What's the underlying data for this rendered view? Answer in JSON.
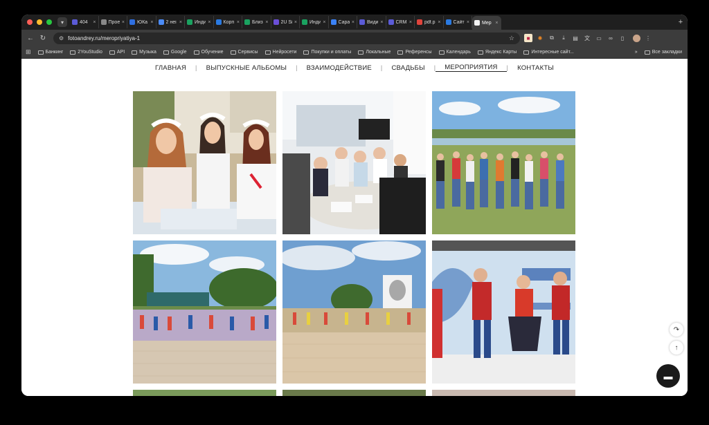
{
  "browser": {
    "tabs": [
      {
        "title": "404",
        "fav": "#5b5bd6"
      },
      {
        "title": "Прое",
        "fav": "#888888"
      },
      {
        "title": "ЮКа",
        "fav": "#2f6fe0"
      },
      {
        "title": "2 неі",
        "fav": "#4b8bf5"
      },
      {
        "title": "Инди",
        "fav": "#1aa260"
      },
      {
        "title": "Корп",
        "fav": "#2a7ae2"
      },
      {
        "title": "Близ",
        "fav": "#1aa260"
      },
      {
        "title": "2U Si",
        "fav": "#6b4fd8"
      },
      {
        "title": "Инди",
        "fav": "#1aa260"
      },
      {
        "title": "Сара",
        "fav": "#3b82f6"
      },
      {
        "title": "Види",
        "fav": "#5b5bd6"
      },
      {
        "title": "CRM",
        "fav": "#5b5bd6"
      },
      {
        "title": "pdf.p",
        "fav": "#e0443c"
      },
      {
        "title": "Сайт",
        "fav": "#2a7ae2"
      },
      {
        "title": "Мер",
        "fav": "#f2f2f2"
      }
    ],
    "active_tab_index": 14,
    "url": "fotoandrey.ru/meropriyatiya-1",
    "bookmarks": [
      "Банкинг",
      "2YouStudio",
      "API",
      "Музыка",
      "Google",
      "Обучение",
      "Сервисы",
      "Нейросети",
      "Покупки и оплаты",
      "Локальные",
      "Референсы",
      "Календарь",
      "Яндекс Карты",
      "Интересные сайт..."
    ],
    "bookmarks_more": "»",
    "all_bookmarks": "Все закладки"
  },
  "site": {
    "nav": [
      "ГЛАВНАЯ",
      "ВЫПУСКНЫЕ АЛЬБОМЫ",
      "ВЗАИМОДЕЙСТВИЕ",
      "СВАДЬБЫ",
      "МЕРОПРИЯТИЯ",
      "КОНТАКТЫ"
    ],
    "nav_current": "МЕРОПРИЯТИЯ",
    "photos": [
      {
        "name": "photo-girls-flower-wreaths"
      },
      {
        "name": "photo-meeting-table"
      },
      {
        "name": "photo-group-riverbank"
      },
      {
        "name": "photo-large-crowd-lawn"
      },
      {
        "name": "photo-crowd-portrait-monument"
      },
      {
        "name": "photo-singers-stage"
      }
    ]
  },
  "colors": {
    "chat": "#1a1a1a",
    "nav_text": "#222222"
  }
}
